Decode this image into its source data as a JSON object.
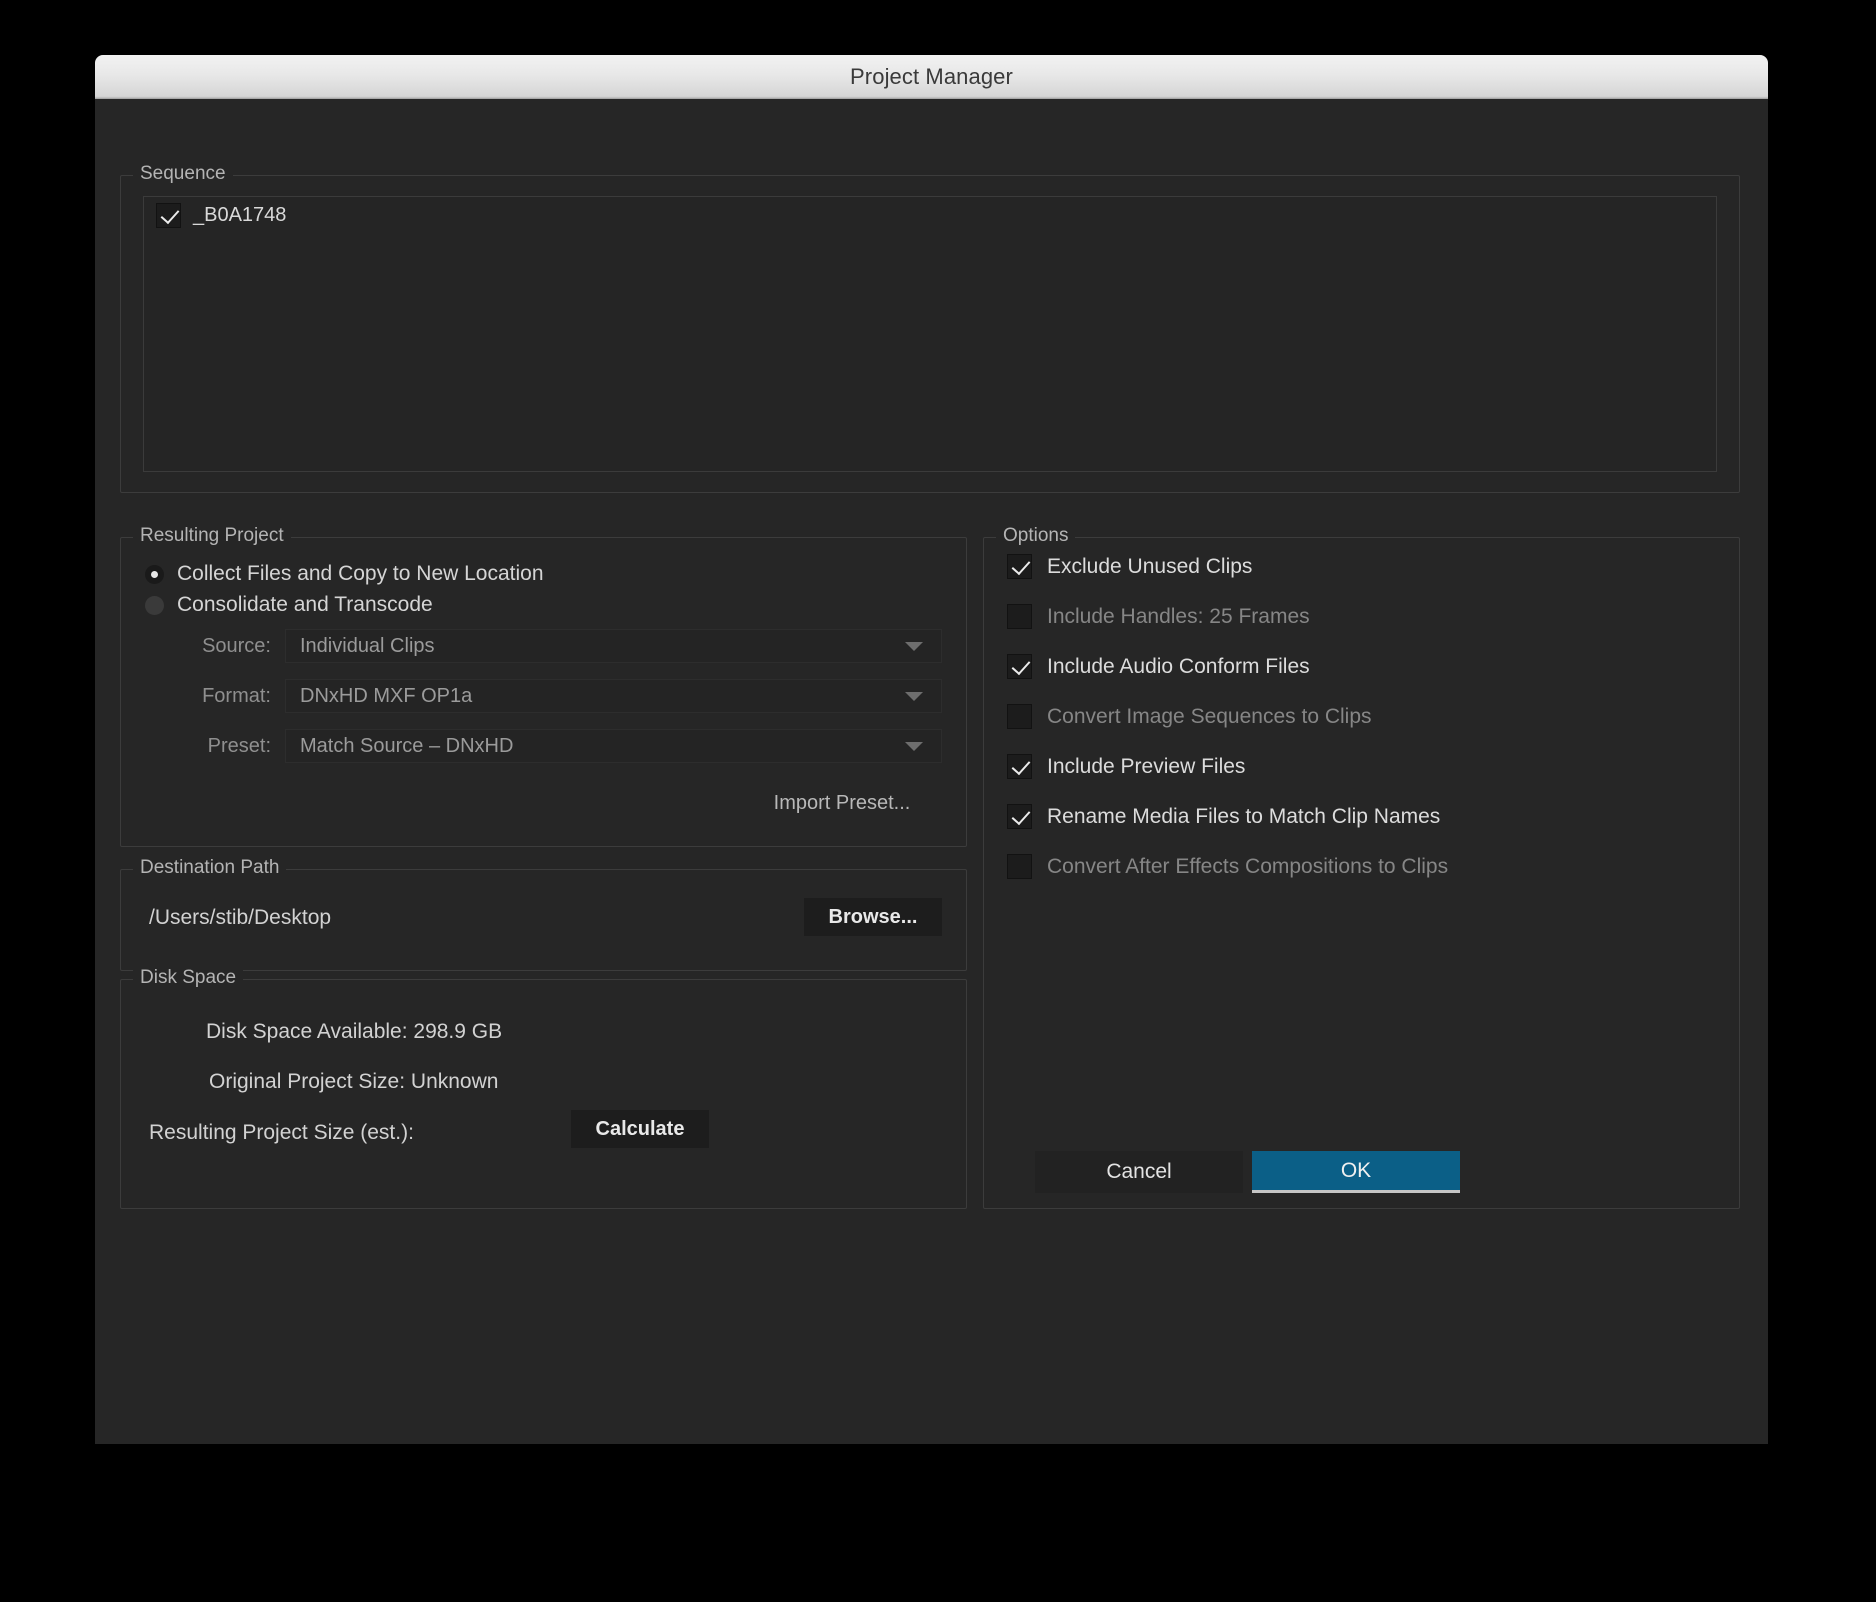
{
  "window": {
    "title": "Project Manager"
  },
  "sequence": {
    "legend": "Sequence",
    "items": [
      {
        "label": "_B0A1748",
        "checked": true
      }
    ]
  },
  "resulting_project": {
    "legend": "Resulting Project",
    "radio_options": [
      {
        "label": "Collect Files and Copy to New Location",
        "selected": true
      },
      {
        "label": "Consolidate and Transcode",
        "selected": false
      }
    ],
    "fields": [
      {
        "label": "Source:",
        "value": "Individual Clips",
        "icon": "chevron-down-icon"
      },
      {
        "label": "Format:",
        "value": "DNxHD MXF OP1a",
        "icon": "chevron-down-icon"
      },
      {
        "label": "Preset:",
        "value": "Match Source – DNxHD",
        "icon": "chevron-down-icon"
      }
    ],
    "import_preset_label": "Import Preset..."
  },
  "destination_path": {
    "legend": "Destination Path",
    "path": "/Users/stib/Desktop",
    "browse_label": "Browse..."
  },
  "disk_space": {
    "legend": "Disk Space",
    "available_label": "Disk Space Available:  298.9 GB",
    "original_size_label": "Original Project Size:  Unknown",
    "resulting_size_label": "Resulting Project Size (est.):",
    "calculate_label": "Calculate"
  },
  "options": {
    "legend": "Options",
    "items": [
      {
        "label": "Exclude Unused Clips",
        "checked": true,
        "enabled": true
      },
      {
        "label": "Include Handles:  25 Frames",
        "checked": false,
        "enabled": false
      },
      {
        "label": "Include Audio Conform Files",
        "checked": true,
        "enabled": true
      },
      {
        "label": "Convert Image Sequences to Clips",
        "checked": false,
        "enabled": false
      },
      {
        "label": "Include Preview Files",
        "checked": true,
        "enabled": true
      },
      {
        "label": "Rename Media Files to Match Clip Names",
        "checked": true,
        "enabled": true
      },
      {
        "label": "Convert After Effects Compositions to Clips",
        "checked": false,
        "enabled": false
      }
    ]
  },
  "footer": {
    "cancel_label": "Cancel",
    "ok_label": "OK"
  },
  "colors": {
    "dialog_bg": "#262626",
    "accent_ok": "#0b5f87",
    "titlebar_text": "#3a3a3a",
    "text_primary": "#d5d5d5",
    "text_disabled": "#868686"
  }
}
